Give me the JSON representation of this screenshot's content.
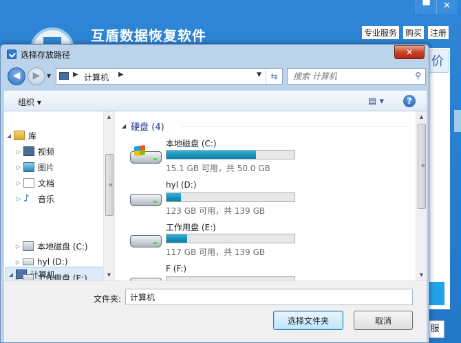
{
  "background_app": {
    "title": "互盾数据恢复软件",
    "links": [
      "专业服务",
      "购买",
      "注册"
    ],
    "window_buttons": [
      "▀",
      "✕"
    ],
    "price_label": "价",
    "service_label": "服"
  },
  "dialog": {
    "title": "选择存放路径",
    "close_label": "✕",
    "address": {
      "crumb": "计算机"
    },
    "search": {
      "placeholder": "搜索 计算机"
    },
    "toolbar": {
      "organize_label": "组织 ▾",
      "view_label": "▤ ▾",
      "help_label": "?"
    },
    "nav_pane": {
      "items": [
        {
          "label": "库",
          "arrow": "◢"
        },
        {
          "label": "视频",
          "arrow": "▷"
        },
        {
          "label": "图片",
          "arrow": "▷"
        },
        {
          "label": "文档",
          "arrow": "▷"
        },
        {
          "label": "音乐",
          "arrow": "▷"
        },
        {
          "label": "计算机",
          "arrow": "◢"
        },
        {
          "label": "本地磁盘 (C:)",
          "arrow": "▷"
        },
        {
          "label": "hyl (D:)",
          "arrow": "▷"
        },
        {
          "label": "工作用盘 (E:)",
          "arrow": "▷"
        }
      ]
    },
    "group": {
      "title": "硬盘 (4)"
    },
    "drives": [
      {
        "name": "本地磁盘 (C:)",
        "free_text": "15.1 GB 可用，共 50.0 GB",
        "used_fraction": 0.7,
        "system": true
      },
      {
        "name": "hyl (D:)",
        "free_text": "123 GB 可用，共 139 GB",
        "used_fraction": 0.115,
        "system": false
      },
      {
        "name": "工作用盘 (E:)",
        "free_text": "117 GB 可用，共 139 GB",
        "used_fraction": 0.16,
        "system": false
      },
      {
        "name": "F (F:)",
        "free_text": "",
        "used_fraction": 0.0,
        "system": false
      }
    ],
    "bottom": {
      "folder_label": "文件夹:",
      "folder_value": "计算机",
      "select_button": "选择文件夹",
      "cancel_button": "取消"
    }
  },
  "colors": {
    "app_blue": "#2f86d6",
    "group_header": "#1e3287",
    "bar_fill": "#178fb6",
    "close_red": "#c7432a"
  }
}
